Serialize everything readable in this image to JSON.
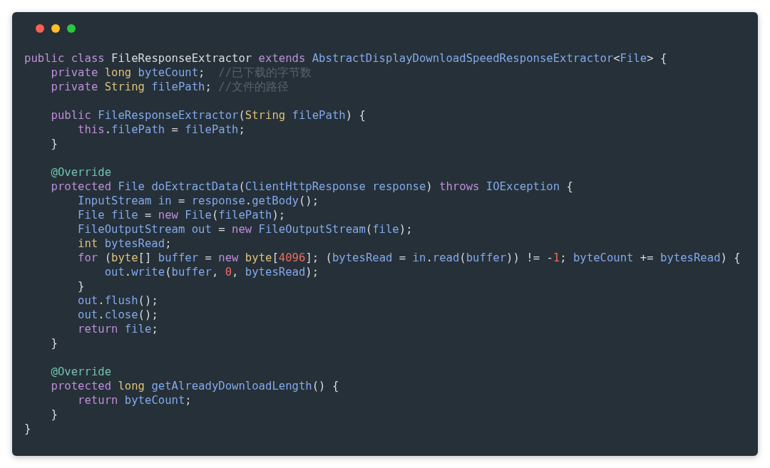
{
  "code_lines": [
    {
      "gap_before": false,
      "tokens": [
        {
          "kind": "keyword",
          "text": "public class"
        },
        {
          "kind": "plain",
          "text": " FileResponseExtractor "
        },
        {
          "kind": "keyword",
          "text": "extends"
        },
        {
          "kind": "name",
          "text": " AbstractDisplayDownloadSpeedResponseExtractor"
        },
        {
          "kind": "plain",
          "text": "<"
        },
        {
          "kind": "name",
          "text": "File"
        },
        {
          "kind": "plain",
          "text": "> {"
        }
      ],
      "children": [
        {
          "gap_before": false,
          "tokens": [
            {
              "kind": "keyword",
              "text": "private"
            },
            {
              "kind": "type",
              "text": " long"
            },
            {
              "kind": "name",
              "text": " byteCount"
            },
            {
              "kind": "plain",
              "text": ";"
            },
            {
              "kind": "comment",
              "text": "  //已下载的字节数"
            }
          ]
        },
        {
          "gap_before": false,
          "tokens": [
            {
              "kind": "keyword",
              "text": "private"
            },
            {
              "kind": "type",
              "text": " String"
            },
            {
              "kind": "name",
              "text": " filePath"
            },
            {
              "kind": "plain",
              "text": ";"
            },
            {
              "kind": "comment",
              "text": " //文件的路径"
            }
          ]
        },
        {
          "gap_before": true,
          "tokens": [
            {
              "kind": "keyword",
              "text": "public"
            },
            {
              "kind": "name",
              "text": " FileResponseExtractor"
            },
            {
              "kind": "plain",
              "text": "("
            },
            {
              "kind": "type",
              "text": "String"
            },
            {
              "kind": "name",
              "text": " filePath"
            },
            {
              "kind": "plain",
              "text": ") {"
            }
          ],
          "children": [
            {
              "gap_before": false,
              "tokens": [
                {
                  "kind": "keyword",
                  "text": "this"
                },
                {
                  "kind": "plain",
                  "text": "."
                },
                {
                  "kind": "name",
                  "text": "filePath"
                },
                {
                  "kind": "plain",
                  "text": " = "
                },
                {
                  "kind": "name",
                  "text": "filePath"
                },
                {
                  "kind": "plain",
                  "text": ";"
                }
              ]
            }
          ]
        },
        {
          "gap_before": false,
          "tokens": [
            {
              "kind": "plain",
              "text": "}"
            }
          ]
        },
        {
          "gap_before": true,
          "tokens": [
            {
              "kind": "annotation",
              "text": "@Override"
            }
          ]
        },
        {
          "gap_before": false,
          "tokens": [
            {
              "kind": "keyword",
              "text": "protected"
            },
            {
              "kind": "name",
              "text": " File doExtractData"
            },
            {
              "kind": "plain",
              "text": "("
            },
            {
              "kind": "name",
              "text": "ClientHttpResponse response"
            },
            {
              "kind": "plain",
              "text": ") "
            },
            {
              "kind": "keyword",
              "text": "throws"
            },
            {
              "kind": "name",
              "text": " IOException"
            },
            {
              "kind": "plain",
              "text": " {"
            }
          ],
          "children": [
            {
              "gap_before": false,
              "tokens": [
                {
                  "kind": "name",
                  "text": "InputStream in"
                },
                {
                  "kind": "plain",
                  "text": " = "
                },
                {
                  "kind": "name",
                  "text": "response"
                },
                {
                  "kind": "plain",
                  "text": "."
                },
                {
                  "kind": "name",
                  "text": "getBody"
                },
                {
                  "kind": "plain",
                  "text": "();"
                }
              ]
            },
            {
              "gap_before": false,
              "tokens": [
                {
                  "kind": "name",
                  "text": "File file"
                },
                {
                  "kind": "plain",
                  "text": " = "
                },
                {
                  "kind": "keyword",
                  "text": "new"
                },
                {
                  "kind": "name",
                  "text": " File"
                },
                {
                  "kind": "plain",
                  "text": "("
                },
                {
                  "kind": "name",
                  "text": "filePath"
                },
                {
                  "kind": "plain",
                  "text": ");"
                }
              ]
            },
            {
              "gap_before": false,
              "tokens": [
                {
                  "kind": "name",
                  "text": "FileOutputStream out"
                },
                {
                  "kind": "plain",
                  "text": " = "
                },
                {
                  "kind": "keyword",
                  "text": "new"
                },
                {
                  "kind": "name",
                  "text": " FileOutputStream"
                },
                {
                  "kind": "plain",
                  "text": "("
                },
                {
                  "kind": "name",
                  "text": "file"
                },
                {
                  "kind": "plain",
                  "text": ");"
                }
              ]
            },
            {
              "gap_before": false,
              "tokens": [
                {
                  "kind": "type",
                  "text": "int"
                },
                {
                  "kind": "name",
                  "text": " bytesRead"
                },
                {
                  "kind": "plain",
                  "text": ";"
                }
              ]
            },
            {
              "gap_before": false,
              "tokens": [
                {
                  "kind": "keyword",
                  "text": "for"
                },
                {
                  "kind": "plain",
                  "text": " ("
                },
                {
                  "kind": "type",
                  "text": "byte"
                },
                {
                  "kind": "plain",
                  "text": "[] "
                },
                {
                  "kind": "name",
                  "text": "buffer"
                },
                {
                  "kind": "plain",
                  "text": " = "
                },
                {
                  "kind": "keyword",
                  "text": "new"
                },
                {
                  "kind": "type",
                  "text": " byte"
                },
                {
                  "kind": "plain",
                  "text": "["
                },
                {
                  "kind": "number",
                  "text": "4096"
                },
                {
                  "kind": "plain",
                  "text": "]; ("
                },
                {
                  "kind": "name",
                  "text": "bytesRead"
                },
                {
                  "kind": "plain",
                  "text": " = "
                },
                {
                  "kind": "name",
                  "text": "in"
                },
                {
                  "kind": "plain",
                  "text": "."
                },
                {
                  "kind": "name",
                  "text": "read"
                },
                {
                  "kind": "plain",
                  "text": "("
                },
                {
                  "kind": "name",
                  "text": "buffer"
                },
                {
                  "kind": "plain",
                  "text": ")) != -"
                },
                {
                  "kind": "number",
                  "text": "1"
                },
                {
                  "kind": "plain",
                  "text": "; "
                },
                {
                  "kind": "name",
                  "text": "byteCount"
                },
                {
                  "kind": "plain",
                  "text": " += "
                },
                {
                  "kind": "name",
                  "text": "bytesRead"
                },
                {
                  "kind": "plain",
                  "text": ") {"
                }
              ],
              "children": [
                {
                  "gap_before": false,
                  "tokens": [
                    {
                      "kind": "name",
                      "text": "out"
                    },
                    {
                      "kind": "plain",
                      "text": "."
                    },
                    {
                      "kind": "name",
                      "text": "write"
                    },
                    {
                      "kind": "plain",
                      "text": "("
                    },
                    {
                      "kind": "name",
                      "text": "buffer"
                    },
                    {
                      "kind": "plain",
                      "text": ", "
                    },
                    {
                      "kind": "number",
                      "text": "0"
                    },
                    {
                      "kind": "plain",
                      "text": ", "
                    },
                    {
                      "kind": "name",
                      "text": "bytesRead"
                    },
                    {
                      "kind": "plain",
                      "text": ");"
                    }
                  ]
                }
              ]
            },
            {
              "gap_before": false,
              "tokens": [
                {
                  "kind": "plain",
                  "text": "}"
                }
              ]
            },
            {
              "gap_before": false,
              "tokens": [
                {
                  "kind": "name",
                  "text": "out"
                },
                {
                  "kind": "plain",
                  "text": "."
                },
                {
                  "kind": "name",
                  "text": "flush"
                },
                {
                  "kind": "plain",
                  "text": "();"
                }
              ]
            },
            {
              "gap_before": false,
              "tokens": [
                {
                  "kind": "name",
                  "text": "out"
                },
                {
                  "kind": "plain",
                  "text": "."
                },
                {
                  "kind": "name",
                  "text": "close"
                },
                {
                  "kind": "plain",
                  "text": "();"
                }
              ]
            },
            {
              "gap_before": false,
              "tokens": [
                {
                  "kind": "keyword",
                  "text": "return"
                },
                {
                  "kind": "name",
                  "text": " file"
                },
                {
                  "kind": "plain",
                  "text": ";"
                }
              ]
            }
          ]
        },
        {
          "gap_before": false,
          "tokens": [
            {
              "kind": "plain",
              "text": "}"
            }
          ]
        },
        {
          "gap_before": true,
          "tokens": [
            {
              "kind": "annotation",
              "text": "@Override"
            }
          ]
        },
        {
          "gap_before": false,
          "tokens": [
            {
              "kind": "keyword",
              "text": "protected"
            },
            {
              "kind": "type",
              "text": " long"
            },
            {
              "kind": "name",
              "text": " getAlreadyDownloadLength"
            },
            {
              "kind": "plain",
              "text": "() {"
            }
          ],
          "children": [
            {
              "gap_before": false,
              "tokens": [
                {
                  "kind": "keyword",
                  "text": "return"
                },
                {
                  "kind": "name",
                  "text": " byteCount"
                },
                {
                  "kind": "plain",
                  "text": ";"
                }
              ]
            }
          ]
        },
        {
          "gap_before": false,
          "tokens": [
            {
              "kind": "plain",
              "text": "}"
            }
          ]
        }
      ]
    },
    {
      "gap_before": false,
      "tokens": [
        {
          "kind": "plain",
          "text": "}"
        }
      ]
    }
  ]
}
